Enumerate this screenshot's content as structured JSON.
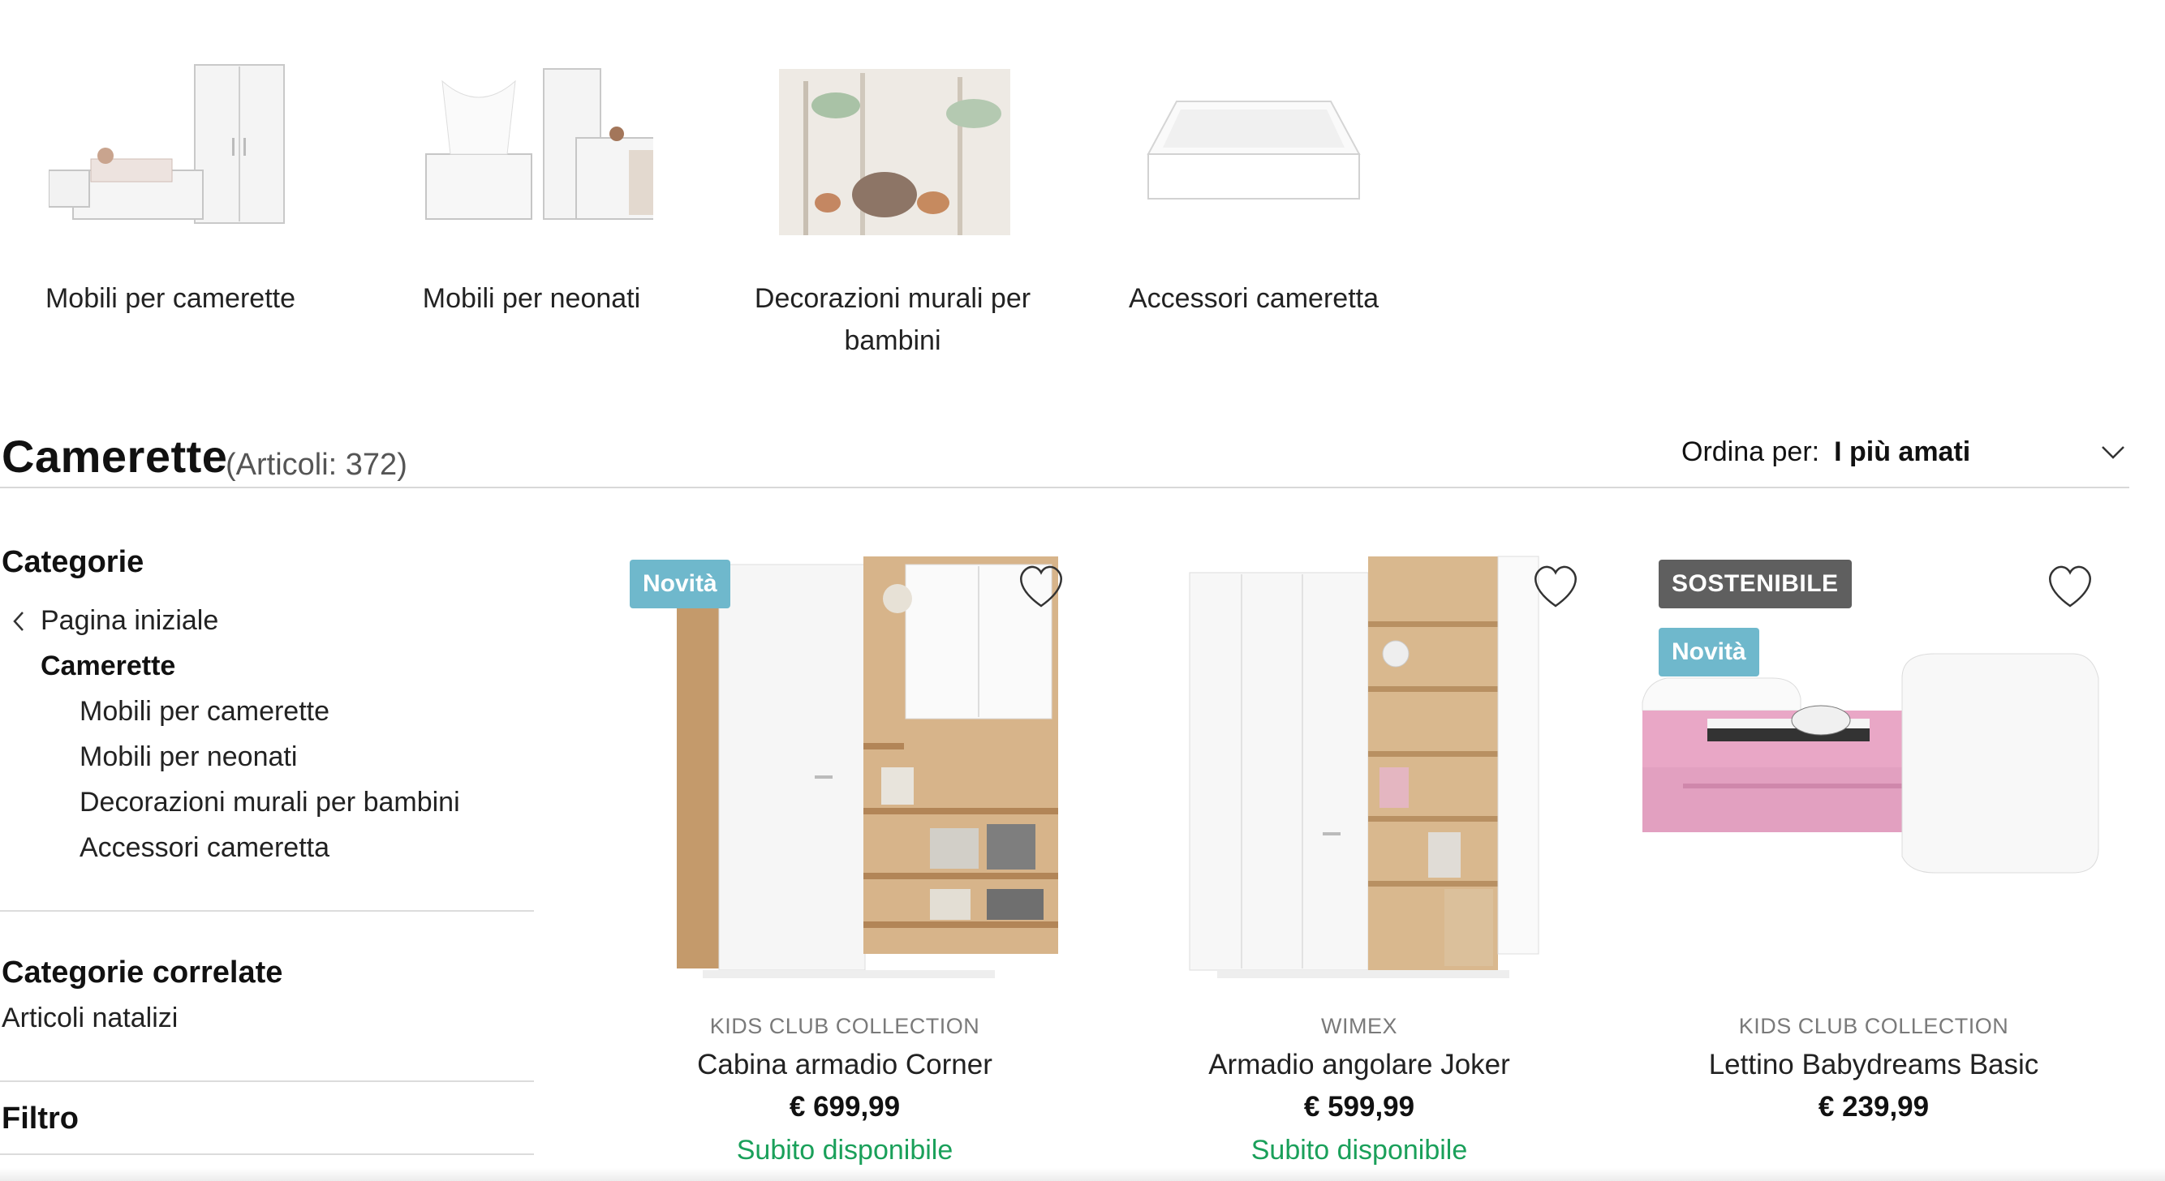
{
  "top_categories": [
    {
      "label": "Mobili per camerette"
    },
    {
      "label": "Mobili per neonati"
    },
    {
      "label": "Decorazioni murali per bambini"
    },
    {
      "label": "Accessori cameretta"
    }
  ],
  "header": {
    "title": "Camerette",
    "count": "(Articoli: 372)",
    "sort_label": "Ordina per:",
    "sort_value": "I più amati"
  },
  "sidebar": {
    "categories_heading": "Categorie",
    "back_link": "Pagina iniziale",
    "current": "Camerette",
    "subcategories": [
      "Mobili per camerette",
      "Mobili per neonati",
      "Decorazioni murali per bambini",
      "Accessori cameretta"
    ],
    "related_heading": "Categorie correlate",
    "related_links": [
      "Articoli natalizi"
    ],
    "filter_heading": "Filtro"
  },
  "products": [
    {
      "brand": "KIDS CLUB COLLECTION",
      "name": "Cabina armadio Corner",
      "price": "€ 699,99",
      "availability": "Subito disponibile",
      "badges": [
        "Novità"
      ]
    },
    {
      "brand": "WIMEX",
      "name": "Armadio angolare Joker",
      "price": "€ 599,99",
      "availability": "Subito disponibile",
      "badges": []
    },
    {
      "brand": "KIDS CLUB COLLECTION",
      "name": "Lettino Babydreams Basic",
      "price": "€ 239,99",
      "availability": "",
      "badges": [
        "SOSTENIBILE",
        "Novità"
      ]
    }
  ],
  "colors": {
    "badge_new": "#6fb8cc",
    "badge_sustainable": "#5f5f5f",
    "availability_green": "#1aa05a"
  },
  "icons": [
    "chevron-left-icon",
    "chevron-down-icon",
    "heart-icon"
  ]
}
